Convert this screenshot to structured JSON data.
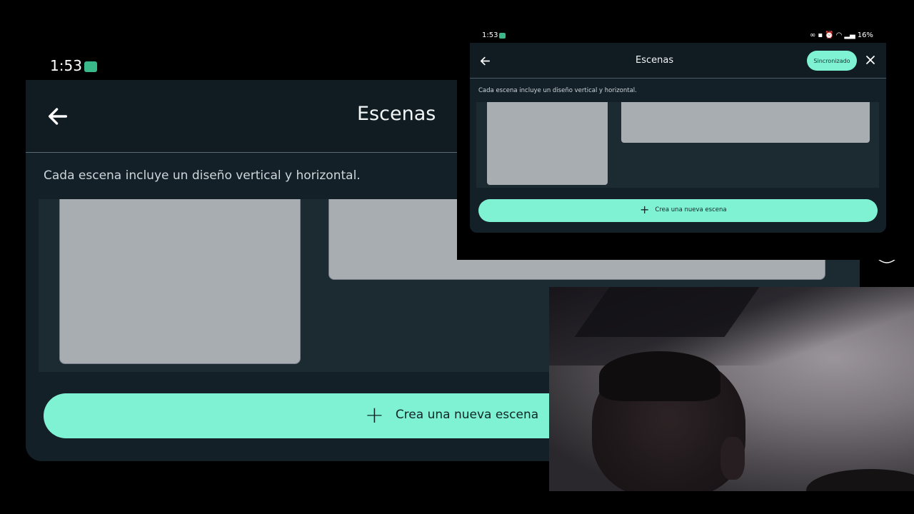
{
  "background_window": {
    "status_time": "1:53",
    "title": "Escenas",
    "description": "Cada escena incluye un diseño vertical y horizontal.",
    "create_button_label": "Crea una nueva escena"
  },
  "overlay_window": {
    "status_time": "1:53",
    "battery": "16%",
    "title": "Escenas",
    "sync_badge": "Sincronizado",
    "description": "Cada escena incluye un diseño vertical y horizontal.",
    "create_button_label": "Crea una nueva escena"
  },
  "colors": {
    "accent": "#7ef2d2",
    "panel": "#142027",
    "header": "#111c22",
    "thumbnail": "#a8adb1"
  },
  "icons": {
    "back": "arrow-left-icon",
    "close": "close-icon",
    "plus": "plus-icon",
    "app_indicator": "app-indicator-icon",
    "accessibility": "accessibility-icon",
    "recents": "recents-icon",
    "home": "home-icon",
    "nav_back": "chevron-left-icon"
  }
}
